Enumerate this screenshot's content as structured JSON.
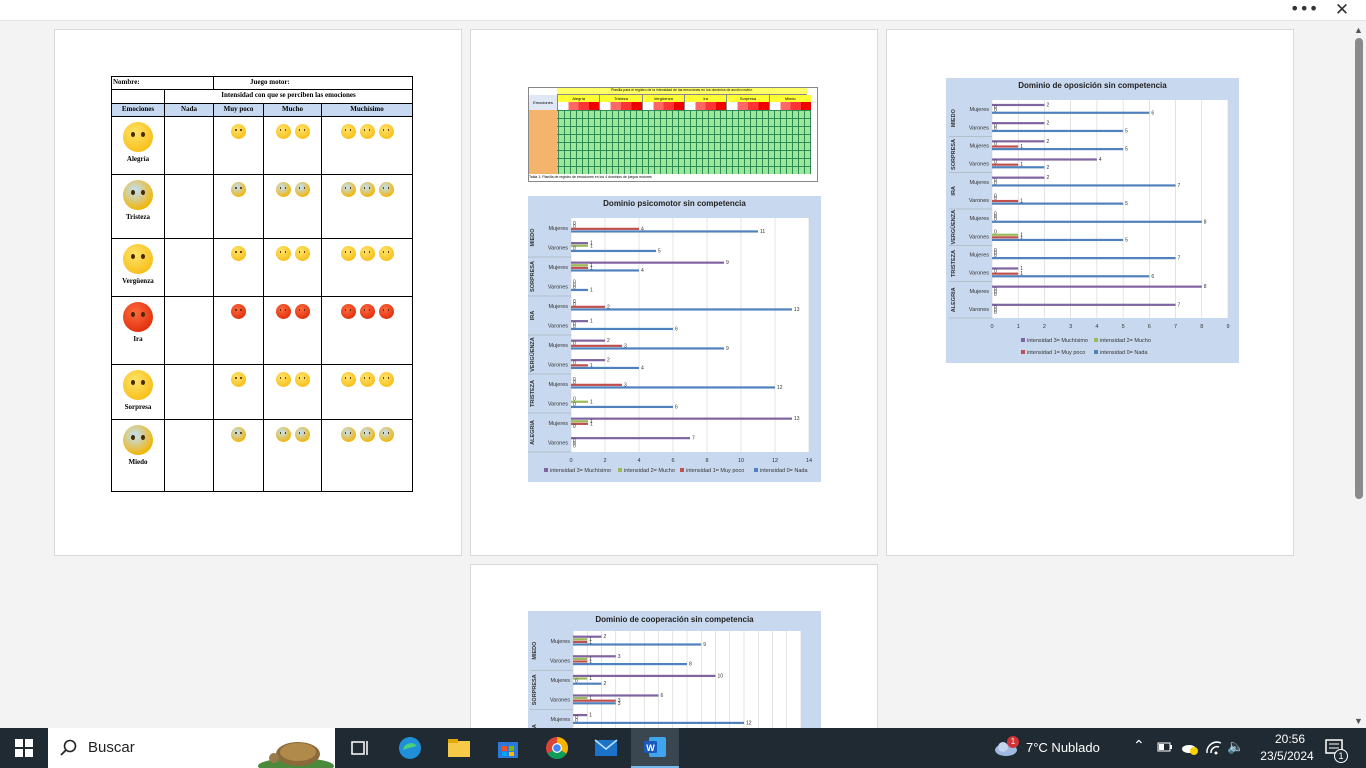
{
  "toolbar": {
    "more_icon": "more-icon",
    "close_icon": "close-icon"
  },
  "emotion_table": {
    "nombre_label": "Nombre:",
    "juego_label": "Juego motor:",
    "intensity_header": "Intensidad con que se perciben las emociones",
    "columns": [
      "Emociones",
      "Nada",
      "Muy poco",
      "Mucho",
      "Muchísimo"
    ],
    "rows": [
      "Alegría",
      "Tristeza",
      "Vergüenza",
      "Ira",
      "Sorpresa",
      "Miedo"
    ]
  },
  "sheet": {
    "title": "Planilla para el registro de la intensidad de las emociones en los dominios de acción motriz.",
    "header": "Emociones",
    "groups": [
      "Alegría",
      "Tristeza",
      "Vergüenza",
      "Ira",
      "Sorpresa",
      "Miedo"
    ],
    "caption": "Tabla 1: Planilla de registro de emociones en los 4 dominios de juegos motores"
  },
  "charts": {
    "psicomotor": {
      "title": "Dominio psicomotor sin competencia",
      "groups": [
        "MIEDO",
        "SORPRESA",
        "IRA",
        "VERGÜENZA",
        "TRISTEZA",
        "ALEGRIA"
      ],
      "rows": [
        "Mujeres",
        "Varones"
      ],
      "ticks": [
        "0",
        "2",
        "4",
        "6",
        "8",
        "10",
        "12",
        "14"
      ],
      "legend": [
        "intensidad 3= Muchísimo",
        "intensidad 2= Mucho",
        "intensidad 1= Muy poco",
        "intensidad 0= Nada"
      ]
    },
    "oposicion": {
      "title": "Dominio de oposición sin competencia",
      "groups": [
        "MIEDO",
        "SORPRESA",
        "IRA",
        "VERGÜENZA",
        "TRISTEZA",
        "ALEGRIA"
      ],
      "rows": [
        "Mujeres",
        "Varones"
      ],
      "ticks": [
        "0",
        "1",
        "2",
        "3",
        "4",
        "5",
        "6",
        "7",
        "8",
        "9"
      ],
      "legend": [
        "intensidad 3= Muchísimo",
        "intensidad 2= Mucho",
        "intensidad 1= Muy poco",
        "intensidad 0= Nada"
      ]
    },
    "cooperacion": {
      "title": "Dominio de cooperación sin competencia",
      "groups": [
        "MIEDO",
        "SORPRESA",
        "IRA"
      ],
      "rows": [
        "Mujeres",
        "Varones"
      ]
    }
  },
  "chart_data": [
    {
      "type": "bar",
      "title": "Dominio psicomotor sin competencia",
      "orientation": "horizontal",
      "xlim": [
        0,
        14
      ],
      "categories": [
        "MIEDO Mujeres",
        "MIEDO Varones",
        "SORPRESA Mujeres",
        "SORPRESA Varones",
        "IRA Mujeres",
        "IRA Varones",
        "VERGÜENZA Mujeres",
        "VERGÜENZA Varones",
        "TRISTEZA Mujeres",
        "TRISTEZA Varones",
        "ALEGRIA Mujeres",
        "ALEGRIA Varones"
      ],
      "series": [
        {
          "name": "intensidad 3= Muchísimo",
          "color": "#8064a2",
          "values": [
            0,
            1,
            9,
            0,
            0,
            1,
            2,
            2,
            0,
            0,
            13,
            7
          ]
        },
        {
          "name": "intensidad 2= Mucho",
          "color": "#9bbb59",
          "values": [
            0,
            1,
            1,
            0,
            0,
            0,
            0,
            0,
            0,
            1,
            1,
            0
          ]
        },
        {
          "name": "intensidad 1= Muy poco",
          "color": "#c0504d",
          "values": [
            4,
            0,
            1,
            0,
            2,
            0,
            3,
            1,
            3,
            0,
            1,
            0
          ]
        },
        {
          "name": "intensidad 0= Nada",
          "color": "#4f81bd",
          "values": [
            11,
            5,
            4,
            1,
            13,
            6,
            9,
            4,
            12,
            6,
            0,
            0
          ]
        }
      ]
    },
    {
      "type": "bar",
      "title": "Dominio de oposición sin competencia",
      "orientation": "horizontal",
      "xlim": [
        0,
        9
      ],
      "categories": [
        "MIEDO Mujeres",
        "MIEDO Varones",
        "SORPRESA Mujeres",
        "SORPRESA Varones",
        "IRA Mujeres",
        "IRA Varones",
        "VERGÜENZA Mujeres",
        "VERGÜENZA Varones",
        "TRISTEZA Mujeres",
        "TRISTEZA Varones",
        "ALEGRIA Mujeres",
        "ALEGRIA Varones"
      ],
      "series": [
        {
          "name": "intensidad 3= Muchísimo",
          "color": "#8064a2",
          "values": [
            2,
            2,
            2,
            4,
            2,
            0,
            0,
            0,
            0,
            1,
            8,
            7
          ]
        },
        {
          "name": "intensidad 2= Mucho",
          "color": "#9bbb59",
          "values": [
            0,
            0,
            0,
            0,
            0,
            0,
            0,
            1,
            0,
            0,
            0,
            0
          ]
        },
        {
          "name": "intensidad 1= Muy poco",
          "color": "#c0504d",
          "values": [
            0,
            0,
            1,
            1,
            0,
            1,
            0,
            1,
            0,
            1,
            0,
            0
          ]
        },
        {
          "name": "intensidad 0= Nada",
          "color": "#4f81bd",
          "values": [
            6,
            5,
            5,
            2,
            7,
            5,
            8,
            5,
            7,
            6,
            0,
            0
          ]
        }
      ]
    },
    {
      "type": "bar",
      "title": "Dominio de cooperación sin competencia",
      "orientation": "horizontal",
      "categories": [
        "MIEDO Mujeres",
        "MIEDO Varones",
        "SORPRESA Mujeres",
        "SORPRESA Varones",
        "IRA Mujeres"
      ],
      "series": [
        {
          "color": "#8064a2",
          "values": [
            2,
            3,
            10,
            6,
            1
          ]
        },
        {
          "color": "#9bbb59",
          "values": [
            1,
            1,
            1,
            1,
            0
          ]
        },
        {
          "color": "#c0504d",
          "values": [
            1,
            1,
            0,
            3,
            0
          ]
        },
        {
          "color": "#4f81bd",
          "values": [
            9,
            8,
            2,
            3,
            12
          ]
        }
      ]
    }
  ],
  "taskbar": {
    "search_placeholder": "Buscar",
    "weather": "7°C  Nublado",
    "weather_badge": "1",
    "time": "20:56",
    "date": "23/5/2024",
    "notif_count": "1"
  }
}
